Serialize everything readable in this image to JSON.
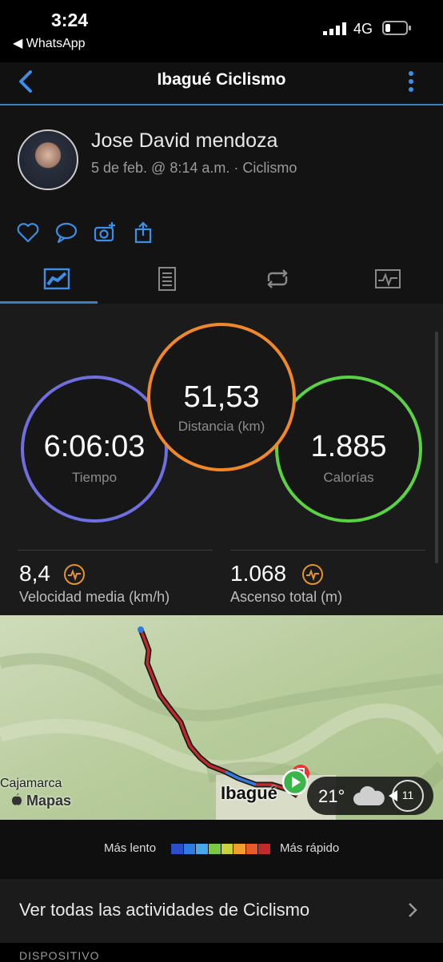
{
  "status_bar": {
    "time": "3:24",
    "back_app": "◀ WhatsApp",
    "network": "4G"
  },
  "header": {
    "title": "Ibagué Ciclismo"
  },
  "profile": {
    "name": "Jose David mendoza",
    "meta": "5 de feb. @ 8:14 a.m. · Ciclismo"
  },
  "stats": {
    "distance": {
      "value": "51,53",
      "label": "Distancia (km)"
    },
    "time": {
      "value": "6:06:03",
      "label": "Tiempo"
    },
    "calories": {
      "value": "1.885",
      "label": "Calorías"
    },
    "avg_speed": {
      "value": "8,4",
      "label": "Velocidad media (km/h)"
    },
    "ascent": {
      "value": "1.068",
      "label": "Ascenso total (m)"
    }
  },
  "map": {
    "city_label": "Ibagué",
    "town_label": "Cajamarca",
    "attribution": "Mapas",
    "weather_temp": "21°",
    "wind_speed": "11"
  },
  "legend": {
    "slow_label": "Más lento",
    "fast_label": "Más rápido",
    "colors": [
      "#2a4fc9",
      "#2f7be0",
      "#48a8e8",
      "#7ac943",
      "#c8d43a",
      "#f0a030",
      "#e85a2a",
      "#c02a2a"
    ]
  },
  "link": {
    "label": "Ver todas las actividades de Ciclismo"
  },
  "section": {
    "device_label": "DISPOSITIVO"
  },
  "colors": {
    "accent": "#3d7fc6",
    "time_ring": "#6f6fe0",
    "distance_ring": "#f0882a",
    "calories_ring": "#5ad243"
  }
}
